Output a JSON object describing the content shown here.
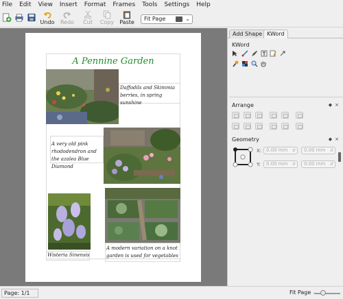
{
  "menu": [
    "File",
    "Edit",
    "View",
    "Insert",
    "Format",
    "Frames",
    "Tools",
    "Settings",
    "Help"
  ],
  "toolbar": {
    "undo": "Undo",
    "redo": "Redo",
    "cut": "Cut",
    "copy": "Copy",
    "paste": "Paste",
    "zoom_value": "Fit Page"
  },
  "document": {
    "title": "A Pennine Garden",
    "captions": [
      "Daffodils and Skimmia berries, in spring sunshine",
      "A very old pink rhododendron and the azalea Blue Diamond",
      "Wisteria Sinensis",
      "A modern variation on a knot garden is used for vegetables"
    ],
    "title_color": "#1d8d2a"
  },
  "dock": {
    "tabs": [
      "Add Shape",
      "KWord"
    ],
    "active_tab": "KWord",
    "sections": {
      "kword": "KWord",
      "arrange": "Arrange",
      "geometry": "Geometry"
    },
    "geometry": {
      "x_label": "X:",
      "y_label": "Y:",
      "x_value": "0.00 mm",
      "y_value": "0.00 mm",
      "w_value": "0.00 mm",
      "h_value": "0.00 mm"
    }
  },
  "status": {
    "page": "Page: 1/1",
    "zoom": "Fit Page"
  }
}
